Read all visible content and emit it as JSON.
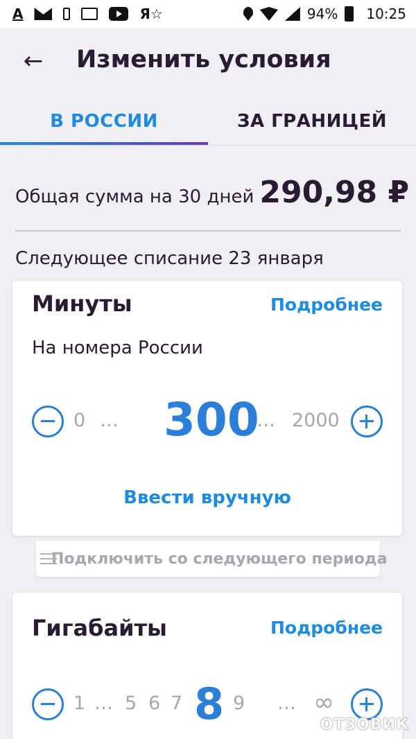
{
  "status_bar": {
    "icons": [
      "a-underline-icon",
      "mail-icon",
      "battery-small-icon",
      "calendar-icon",
      "youtube-icon",
      "yandex-icon",
      "location-icon",
      "wifi-icon",
      "signal-icon",
      "battery-icon"
    ],
    "battery": "94%",
    "time": "10:25"
  },
  "header": {
    "title": "Изменить условия",
    "tabs": [
      {
        "label": "В РОССИИ",
        "active": true
      },
      {
        "label": "ЗА ГРАНИЦЕЙ",
        "active": false
      }
    ]
  },
  "summary": {
    "total_label": "Общая сумма на 30 дней",
    "total_amount": "290,98 ₽",
    "next_charge": "Следующее списание 23 января"
  },
  "minutes": {
    "title": "Минуты",
    "more_link": "Подробнее",
    "subtitle": "На номера России",
    "min": "0",
    "ellipsis": "…",
    "value": "300",
    "max": "2000",
    "manual_link": "Ввести вручную",
    "from_next_period": "Подключить со следующего периода"
  },
  "gigabytes": {
    "title": "Гигабайты",
    "more_link": "Подробнее",
    "scale": [
      "1",
      "…",
      "5",
      "6",
      "7",
      "8",
      "9",
      "…",
      "∞"
    ],
    "selected": "8"
  },
  "watermark": "ОТЗОВИК",
  "colors": {
    "accent": "#1e8be0",
    "text": "#2b1a33",
    "background": "#f0eff4"
  }
}
